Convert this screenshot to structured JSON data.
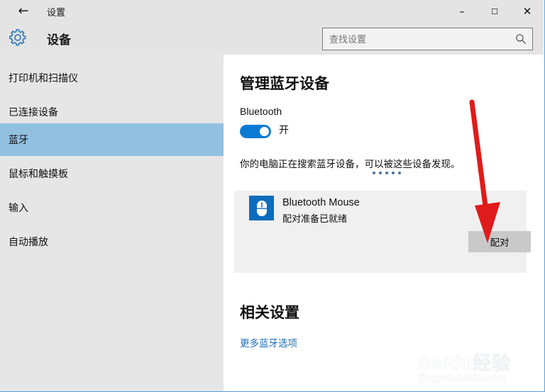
{
  "window": {
    "title": "设置",
    "back_icon": "back-arrow-icon",
    "controls": {
      "minimize": "–",
      "maximize": "☐",
      "close": "✕"
    }
  },
  "header": {
    "gear_icon": "gear-icon",
    "page_title": "设备",
    "accent_color": "#0a7bd4"
  },
  "search": {
    "placeholder": "查找设置",
    "value": "",
    "icon": "search-icon"
  },
  "sidebar": {
    "items": [
      {
        "label": "打印机和扫描仪",
        "selected": false
      },
      {
        "label": "已连接设备",
        "selected": false
      },
      {
        "label": "蓝牙",
        "selected": true
      },
      {
        "label": "鼠标和触摸板",
        "selected": false
      },
      {
        "label": "输入",
        "selected": false
      },
      {
        "label": "自动播放",
        "selected": false
      }
    ],
    "selected_color": "#92c0e0",
    "background_color": "#e6e6e6"
  },
  "main": {
    "heading": "管理蓝牙设备",
    "bluetooth_label": "Bluetooth",
    "toggle": {
      "state_label": "开",
      "on": true,
      "color": "#0a7bd4"
    },
    "description": "你的电脑正在搜索蓝牙设备，可以被这些设备发现。",
    "searching_dots": 5,
    "device": {
      "icon": "bluetooth-mouse-icon",
      "name": "Bluetooth Mouse",
      "status": "配对准备已就绪",
      "pair_button": "配对",
      "icon_color": "#0c6cbd"
    },
    "related": {
      "heading": "相关设置",
      "link": "更多蓝牙选项",
      "link_color": "#1f6fb5"
    }
  },
  "annotation": {
    "arrow": "red-down-arrow",
    "color": "#e01b1b"
  },
  "watermark": {
    "main": "Baidu经验",
    "sub": "jingyan.baidu.com"
  }
}
